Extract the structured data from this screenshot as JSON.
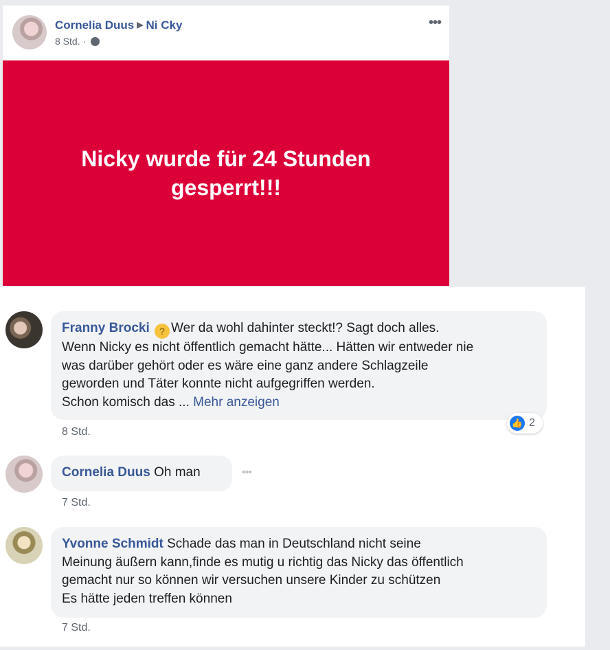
{
  "post": {
    "author": "Cornelia Duus",
    "target": "Ni Cky",
    "time": "8 Std. ·",
    "menu_glyph": "•••",
    "banner_text": "Nicky wurde für 24 Stunden gesperrt!!!",
    "banner_color": "#dc0039"
  },
  "comments": [
    {
      "name": "Franny Brocki",
      "emoji": "thinking-face",
      "lines": [
        "Wer da wohl dahinter steckt!? Sagt doch alles.",
        "Wenn Nicky es nicht öffentlich gemacht hätte... Hätten wir entweder nie",
        "was darüber gehört oder es wäre eine ganz andere Schlagzeile",
        "geworden und Täter konnte nicht aufgegriffen werden.",
        "Schon komisch das ..."
      ],
      "more_link": "Mehr anzeigen",
      "time": "8 Std.",
      "reaction_count": "2",
      "reaction_icon": "like-icon"
    },
    {
      "name": "Cornelia Duus",
      "text": "Oh man",
      "time": "7 Std.",
      "options_glyph": "•••"
    },
    {
      "name": "Yvonne Schmidt",
      "lines": [
        "Schade das man in Deutschland nicht seine",
        "Meinung äußern kann,finde es mutig u richtig das Nicky das öffentlich",
        "gemacht nur so können wir versuchen unsere Kinder zu schützen",
        "Es hätte jeden treffen können"
      ],
      "time": "7 Std."
    }
  ]
}
